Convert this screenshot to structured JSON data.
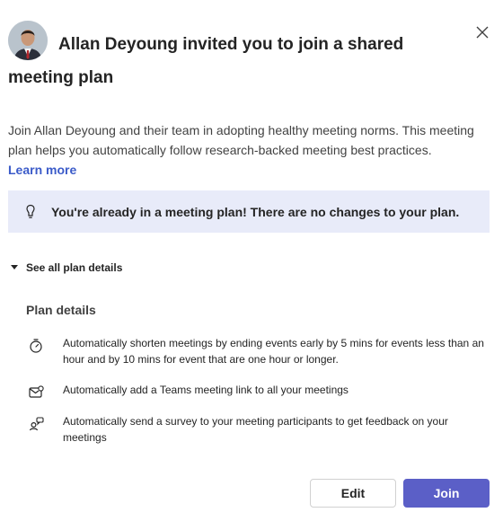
{
  "dialog": {
    "title": "Allan Deyoung invited you to join a shared meeting plan",
    "close_icon": "close-icon",
    "description": "Join Allan Deyoung and their team in adopting healthy meeting norms. This meeting plan helps you automatically follow research-backed meeting best practices.",
    "learn_more": "Learn more"
  },
  "banner": {
    "icon": "lightbulb-icon",
    "text": "You're already in a meeting plan! There are no changes to your plan."
  },
  "disclosure": {
    "label": "See all plan details",
    "expanded": true
  },
  "plan": {
    "heading": "Plan details",
    "items": [
      {
        "icon": "timer-icon",
        "text": "Automatically shorten meetings by ending events early by 5 mins for events less than an hour and by 10 mins for event that are one hour or longer."
      },
      {
        "icon": "mail-link-icon",
        "text": "Automatically add a Teams meeting link to all your meetings"
      },
      {
        "icon": "survey-people-icon",
        "text": "Automatically send a survey to your meeting participants to get feedback on your meetings"
      }
    ]
  },
  "actions": {
    "edit": "Edit",
    "join": "Join"
  },
  "colors": {
    "primary": "#5b5fc7",
    "link": "#3b5bc9",
    "banner_bg": "#e8ebf9"
  }
}
